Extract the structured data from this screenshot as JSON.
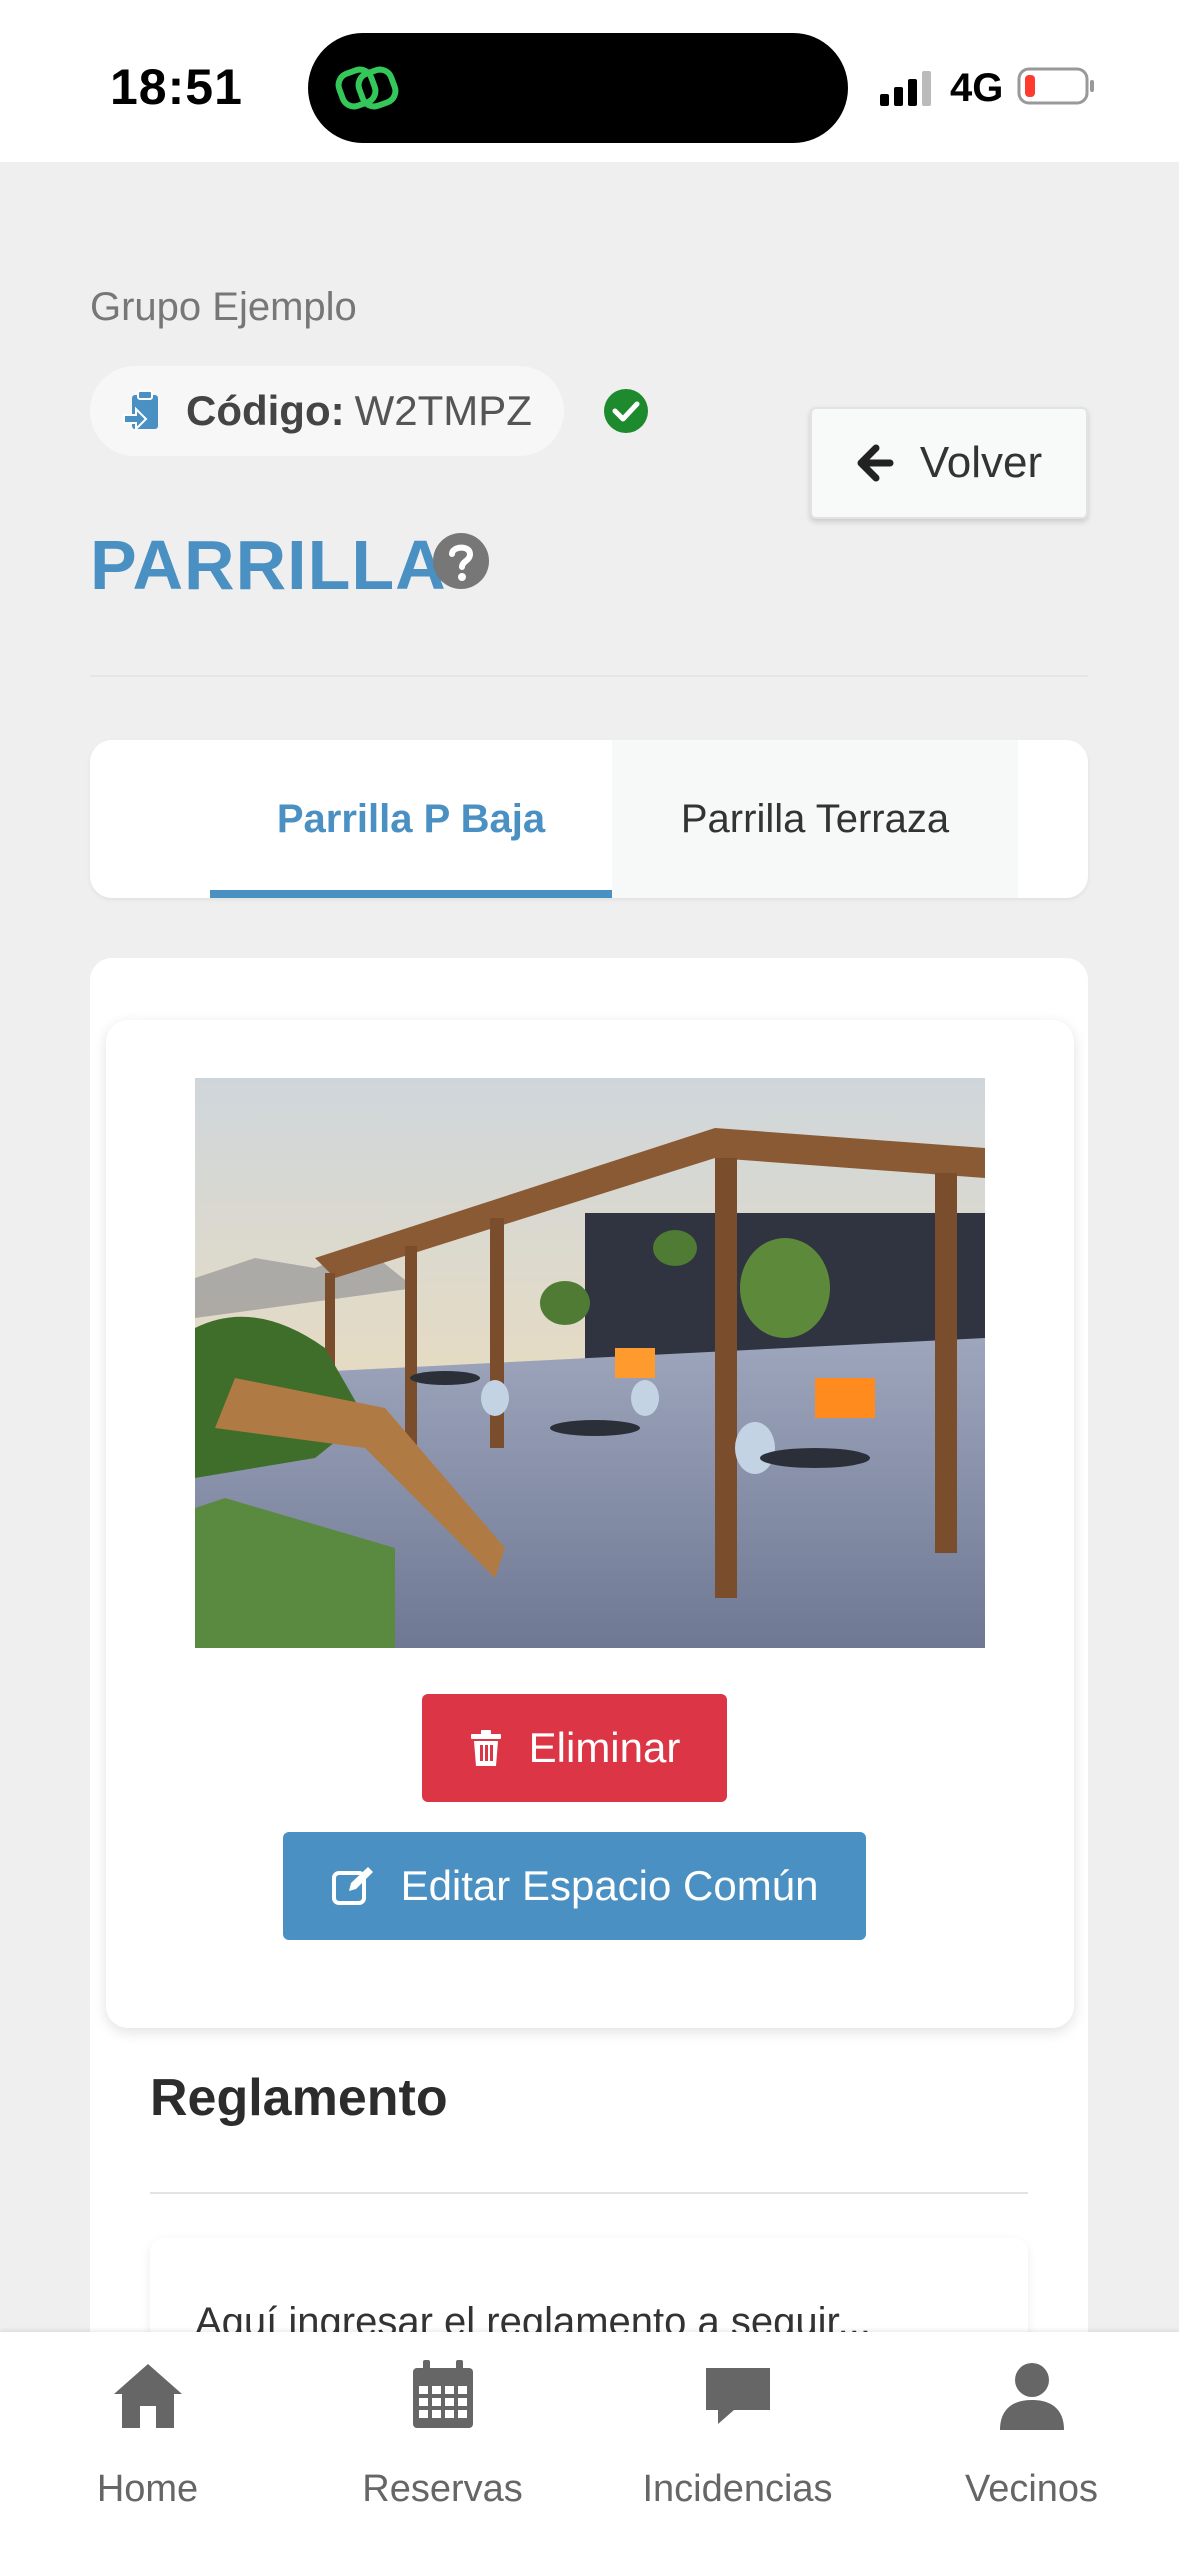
{
  "status_bar": {
    "time": "18:51",
    "network": "4G",
    "app_indicator_icon": "link-icon",
    "battery_color": "#ff3b30"
  },
  "header": {
    "group_name": "Grupo Ejemplo",
    "code_label": "Código:",
    "code_value": "W2TMPZ",
    "back_label": "Volver",
    "page_title": "PARRILLA"
  },
  "tabs": [
    {
      "label": "Parrilla P Baja",
      "active": true
    },
    {
      "label": "Parrilla Terraza",
      "active": false
    }
  ],
  "space_card": {
    "image_icon": "terrace-photo",
    "delete_label": "Eliminar",
    "edit_label": "Editar Espacio Común"
  },
  "rules": {
    "title": "Reglamento",
    "text": "Aquí ingresar el reglamento a seguir..."
  },
  "bottom_nav": [
    {
      "label": "Home",
      "icon": "home-icon"
    },
    {
      "label": "Reservas",
      "icon": "calendar-icon"
    },
    {
      "label": "Incidencias",
      "icon": "chat-icon"
    },
    {
      "label": "Vecinos",
      "icon": "user-icon"
    }
  ],
  "colors": {
    "accent": "#4a90c2",
    "danger": "#dc3545",
    "success": "#1e8a2e",
    "background": "#efefef"
  }
}
